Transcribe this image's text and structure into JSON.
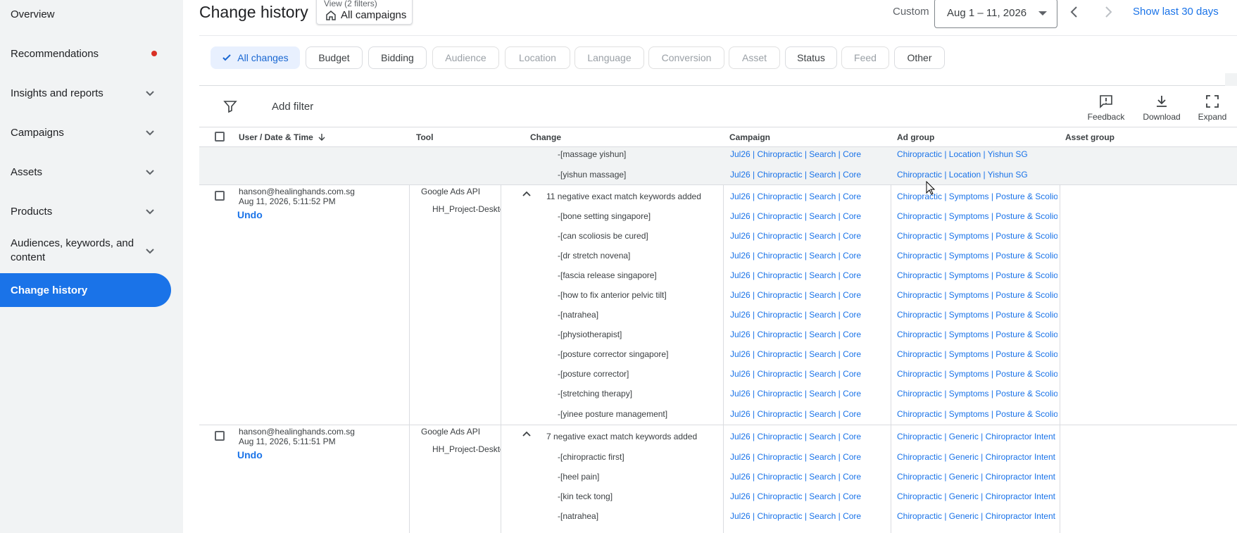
{
  "sidebar": {
    "items": [
      {
        "label": "Overview",
        "has_chevron": false
      },
      {
        "label": "Recommendations",
        "has_dot": true
      },
      {
        "label": "Insights and reports",
        "has_chevron": true
      },
      {
        "label": "Campaigns",
        "has_chevron": true
      },
      {
        "label": "Assets",
        "has_chevron": true
      },
      {
        "label": "Products",
        "has_chevron": true
      },
      {
        "label": "Audiences, keywords, and content",
        "has_chevron": true
      },
      {
        "label": "Change history",
        "active": true
      }
    ]
  },
  "header": {
    "title": "Change history",
    "view_sub": "View (2 filters)",
    "view_main": "All campaigns",
    "custom_label": "Custom",
    "date_range": "Aug 1 – 11, 2026",
    "show_last": "Show last 30 days"
  },
  "chips": [
    {
      "label": "All changes",
      "state": "selected"
    },
    {
      "label": "Budget",
      "state": "enabled"
    },
    {
      "label": "Bidding",
      "state": "enabled"
    },
    {
      "label": "Audience",
      "state": "disabled"
    },
    {
      "label": "Location",
      "state": "disabled"
    },
    {
      "label": "Language",
      "state": "disabled"
    },
    {
      "label": "Conversion",
      "state": "disabled"
    },
    {
      "label": "Asset",
      "state": "disabled"
    },
    {
      "label": "Status",
      "state": "enabled"
    },
    {
      "label": "Feed",
      "state": "disabled"
    },
    {
      "label": "Other",
      "state": "enabled"
    }
  ],
  "toolbar": {
    "add_filter": "Add filter",
    "feedback": "Feedback",
    "download": "Download",
    "expand": "Expand"
  },
  "table": {
    "headers": {
      "user": "User / Date & Time",
      "tool": "Tool",
      "change": "Change",
      "campaign": "Campaign",
      "ad_group": "Ad group",
      "asset_group": "Asset group"
    },
    "prev_group": {
      "rows": [
        {
          "keyword": "-[massage yishun]",
          "campaign": "Jul26 | Chiropractic | Search | Core",
          "ad_group": "Chiropractic | Location | Yishun SG"
        },
        {
          "keyword": "-[yishun massage]",
          "campaign": "Jul26 | Chiropractic | Search | Core",
          "ad_group": "Chiropractic | Location | Yishun SG"
        }
      ]
    },
    "group1": {
      "user": "hanson@healinghands.com.sg",
      "datetime": "Aug 11, 2026, 5:11:52 PM",
      "undo": "Undo",
      "tool": "Google Ads API",
      "tool_sub": "HH_Project-Desktop",
      "summary": "11 negative exact match keywords added",
      "summary_campaign": "Jul26 | Chiropractic | Search | Core",
      "summary_ad_group": "Chiropractic | Symptoms | Posture & Scoliosis",
      "rows": [
        {
          "keyword": "-[bone setting singapore]",
          "campaign": "Jul26 | Chiropractic | Search | Core",
          "ad_group": "Chiropractic | Symptoms | Posture & Scoliosis"
        },
        {
          "keyword": "-[can scoliosis be cured]",
          "campaign": "Jul26 | Chiropractic | Search | Core",
          "ad_group": "Chiropractic | Symptoms | Posture & Scoliosis"
        },
        {
          "keyword": "-[dr stretch novena]",
          "campaign": "Jul26 | Chiropractic | Search | Core",
          "ad_group": "Chiropractic | Symptoms | Posture & Scoliosis"
        },
        {
          "keyword": "-[fascia release singapore]",
          "campaign": "Jul26 | Chiropractic | Search | Core",
          "ad_group": "Chiropractic | Symptoms | Posture & Scoliosis"
        },
        {
          "keyword": "-[how to fix anterior pelvic tilt]",
          "campaign": "Jul26 | Chiropractic | Search | Core",
          "ad_group": "Chiropractic | Symptoms | Posture & Scoliosis"
        },
        {
          "keyword": "-[natrahea]",
          "campaign": "Jul26 | Chiropractic | Search | Core",
          "ad_group": "Chiropractic | Symptoms | Posture & Scoliosis"
        },
        {
          "keyword": "-[physiotherapist]",
          "campaign": "Jul26 | Chiropractic | Search | Core",
          "ad_group": "Chiropractic | Symptoms | Posture & Scoliosis"
        },
        {
          "keyword": "-[posture corrector singapore]",
          "campaign": "Jul26 | Chiropractic | Search | Core",
          "ad_group": "Chiropractic | Symptoms | Posture & Scoliosis"
        },
        {
          "keyword": "-[posture corrector]",
          "campaign": "Jul26 | Chiropractic | Search | Core",
          "ad_group": "Chiropractic | Symptoms | Posture & Scoliosis"
        },
        {
          "keyword": "-[stretching therapy]",
          "campaign": "Jul26 | Chiropractic | Search | Core",
          "ad_group": "Chiropractic | Symptoms | Posture & Scoliosis"
        },
        {
          "keyword": "-[yinee posture management]",
          "campaign": "Jul26 | Chiropractic | Search | Core",
          "ad_group": "Chiropractic | Symptoms | Posture & Scoliosis"
        }
      ]
    },
    "group2": {
      "user": "hanson@healinghands.com.sg",
      "datetime": "Aug 11, 2026, 5:11:51 PM",
      "undo": "Undo",
      "tool": "Google Ads API",
      "tool_sub": "HH_Project-Desktop",
      "summary": "7 negative exact match keywords added",
      "summary_campaign": "Jul26 | Chiropractic | Search | Core",
      "summary_ad_group": "Chiropractic | Generic | Chiropractor Intent",
      "rows": [
        {
          "keyword": "-[chiropractic first]",
          "campaign": "Jul26 | Chiropractic | Search | Core",
          "ad_group": "Chiropractic | Generic | Chiropractor Intent"
        },
        {
          "keyword": "-[heel pain]",
          "campaign": "Jul26 | Chiropractic | Search | Core",
          "ad_group": "Chiropractic | Generic | Chiropractor Intent"
        },
        {
          "keyword": "-[kin teck tong]",
          "campaign": "Jul26 | Chiropractic | Search | Core",
          "ad_group": "Chiropractic | Generic | Chiropractor Intent"
        },
        {
          "keyword": "-[natrahea]",
          "campaign": "Jul26 | Chiropractic | Search | Core",
          "ad_group": "Chiropractic | Generic | Chiropractor Intent"
        }
      ]
    }
  },
  "colors": {
    "accent": "#1a73e8",
    "sidebar_bg": "#f1f3f4",
    "dot": "#d93025",
    "chip_selected_bg": "#e8f0fe"
  }
}
